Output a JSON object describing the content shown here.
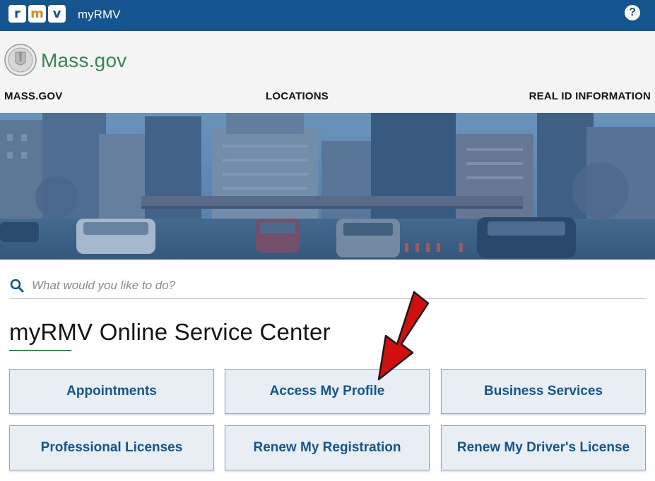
{
  "topbar": {
    "logo_letters": [
      "r",
      "m",
      "v"
    ],
    "app_title": "myRMV",
    "help_glyph": "?",
    "help_icon": "question-circle-icon",
    "bg_color": "#14558f"
  },
  "header": {
    "seal_icon": "massachusetts-seal-icon",
    "wordmark": "Mass.gov",
    "wordmark_color": "#388557",
    "nav": [
      {
        "label": "MASS.GOV"
      },
      {
        "label": "LOCATIONS"
      },
      {
        "label": "REAL ID INFORMATION"
      }
    ]
  },
  "search": {
    "icon": "search-icon",
    "placeholder": "What would you like to do?",
    "value": ""
  },
  "main": {
    "title": "myRMV Online Service Center",
    "services": [
      {
        "label": "Appointments"
      },
      {
        "label": "Access My Profile"
      },
      {
        "label": "Business Services"
      },
      {
        "label": "Professional Licenses"
      },
      {
        "label": "Renew My Registration"
      },
      {
        "label": "Renew My Driver's License"
      }
    ],
    "button_text_color": "#14558f",
    "button_bg_color": "#e8eef4"
  },
  "annotation": {
    "arrow_color": "#d10f0f",
    "arrow_target": "Access My Profile"
  }
}
